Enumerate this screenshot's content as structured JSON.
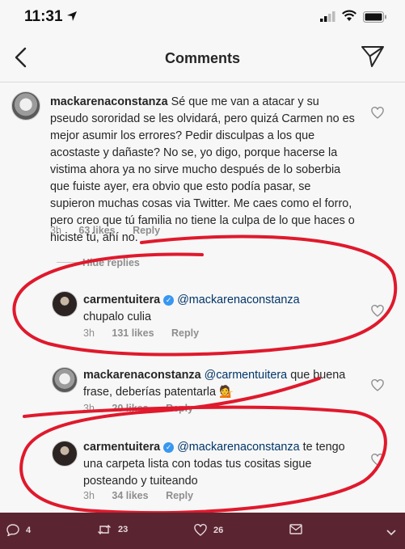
{
  "status": {
    "time": "11:31"
  },
  "header": {
    "title": "Comments"
  },
  "comments": [
    {
      "username": "mackarenaconstanza",
      "text": "Sé que me van a atacar y su pseudo sororidad se les olvidará, pero quizá Carmen no es mejor asumir los errores? Pedir disculpas a los que acostaste y dañaste? No se, yo digo, porque hacerse la vistima ahora ya no sirve mucho después de lo soberbia que fuiste ayer, era obvio que esto podía pasar, se supieron muchas cosas via Twitter. Me caes como el forro, pero creo que tú familia no tiene la culpa de lo que haces o hiciste tú, ahí no.",
      "time": "3h",
      "likes": "63 likes",
      "reply": "Reply"
    },
    {
      "username": "carmentuitera",
      "mention": "@mackarenaconstanza",
      "text": "chupalo culia",
      "time": "3h",
      "likes": "131 likes",
      "reply": "Reply"
    },
    {
      "username": "mackarenaconstanza",
      "mention": "@carmentuitera",
      "text": "que buena frase, deberías patentarla 💁",
      "time": "3h",
      "likes": "20 likes",
      "reply": "Reply"
    },
    {
      "username": "carmentuitera",
      "mention": "@mackarenaconstanza",
      "text": "te tengo una carpeta lista con todas tus cositas sigue posteando y tuiteando",
      "time": "3h",
      "likes": "34 likes",
      "reply": "Reply"
    }
  ],
  "hide_replies": "Hide replies",
  "bottom_bar": {
    "replies": "4",
    "retweets": "23",
    "likes": "26"
  },
  "colors": {
    "accent_red": "#e0192c",
    "bottom_bar": "#5a2531",
    "verified": "#3897f0"
  }
}
